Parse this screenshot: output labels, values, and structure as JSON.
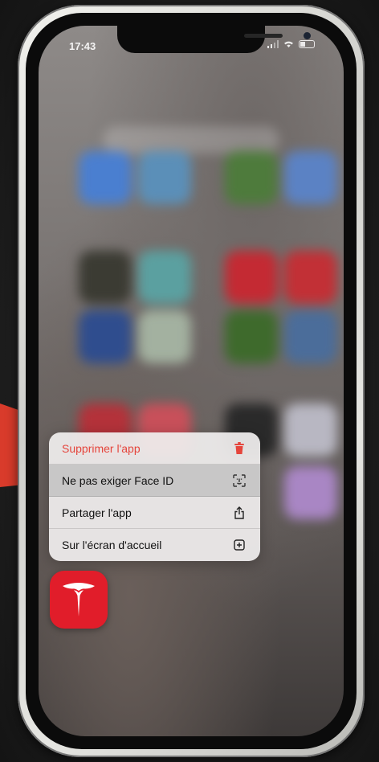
{
  "status_bar": {
    "time": "17:43",
    "signal": "‥ıı",
    "wifi": "⌨"
  },
  "context_menu": {
    "items": [
      {
        "label": "Supprimer l'app",
        "icon": "trash-icon",
        "style": "destructive"
      },
      {
        "label": "Ne pas exiger Face ID",
        "icon": "face-id-icon",
        "style": "highlighted"
      },
      {
        "label": "Partager l'app",
        "icon": "share-icon",
        "style": "normal"
      },
      {
        "label": "Sur l'écran d'accueil",
        "icon": "add-to-home-icon",
        "style": "normal"
      }
    ]
  },
  "app": {
    "name": "Tesla",
    "icon": "tesla-logo",
    "color": "#e11d2a"
  },
  "colors": {
    "destructive": "#e5453c",
    "highlight_marker": "#d93b2b"
  }
}
